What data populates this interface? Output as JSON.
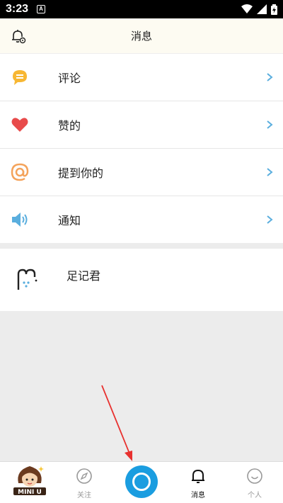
{
  "status": {
    "time": "3:23",
    "badge": "A"
  },
  "header": {
    "title": "消息",
    "icon": "bell-settings-icon"
  },
  "menu": [
    {
      "label": "评论",
      "icon": "comment-icon",
      "color": "#f7b733"
    },
    {
      "label": "赞的",
      "icon": "heart-icon",
      "color": "#e84b4b"
    },
    {
      "label": "提到你的",
      "icon": "at-icon",
      "color": "#f4a35b"
    },
    {
      "label": "通知",
      "icon": "speaker-icon",
      "color": "#5aaede"
    }
  ],
  "footprint": {
    "name": "足记君",
    "icon": "footprint-logo"
  },
  "tabs": [
    {
      "label": "关注",
      "icon": "compass-icon"
    },
    {
      "label": "消息",
      "icon": "bell-icon"
    },
    {
      "label": "个人",
      "icon": "smile-icon"
    }
  ],
  "avatar_text": "MINI U",
  "colors": {
    "accent": "#1a9de0",
    "chevron": "#5aaede",
    "arrow": "#e8312f"
  }
}
